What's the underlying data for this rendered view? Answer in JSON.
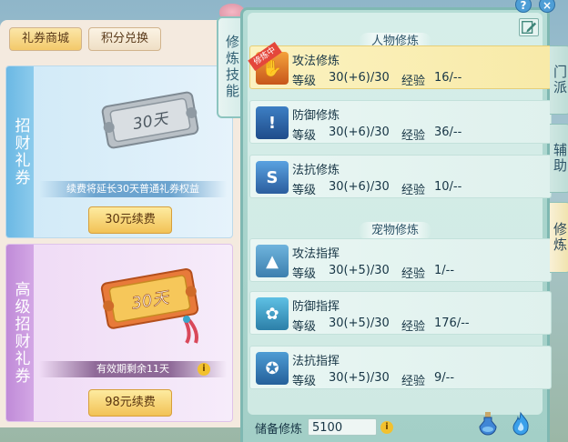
{
  "left_panel": {
    "tabs": {
      "gift_shop": "礼券商城",
      "points_exchange": "积分兑换"
    },
    "ticket_card": {
      "side_title": "招财礼券",
      "badge": "30天",
      "description": "续费将延长30天普通礼券权益",
      "button_label": "30元续费"
    },
    "premium_card": {
      "side_title": "高级招财礼券",
      "badge": "30天",
      "description": "有效期剩余11天",
      "button_label": "98元续费"
    }
  },
  "skill_tab": {
    "label": "修炼技能"
  },
  "sections": {
    "character": "人物修炼",
    "pet": "宠物修炼"
  },
  "labels": {
    "level": "等级",
    "exp": "经验",
    "training": "修炼中"
  },
  "character_skills": [
    {
      "name": "攻法修炼",
      "level": "30(+6)/30",
      "exp": "16/--",
      "active": true
    },
    {
      "name": "防御修炼",
      "level": "30(+6)/30",
      "exp": "36/--",
      "active": false
    },
    {
      "name": "法抗修炼",
      "level": "30(+6)/30",
      "exp": "10/--",
      "active": false
    }
  ],
  "pet_skills": [
    {
      "name": "攻法指挥",
      "level": "30(+5)/30",
      "exp": "1/--"
    },
    {
      "name": "防御指挥",
      "level": "30(+5)/30",
      "exp": "176/--"
    },
    {
      "name": "法抗指挥",
      "level": "30(+5)/30",
      "exp": "9/--"
    }
  ],
  "footer": {
    "reserve_label": "储备修炼",
    "reserve_value": "5100"
  },
  "side_tabs": {
    "sect": "门派",
    "assist": "辅助",
    "training": "修炼"
  },
  "icons": {
    "help": "help-icon",
    "close": "close-icon",
    "edit": "edit-icon",
    "info": "info-icon",
    "potion": "potion-icon",
    "flame": "flame-icon"
  },
  "colors": {
    "active_row": "#fbf2c0",
    "panel_bg": "#cfe9e3",
    "button_gold": "#f2c256",
    "ticket_side": "#6bb8e4",
    "premium_side": "#c08bd8"
  }
}
